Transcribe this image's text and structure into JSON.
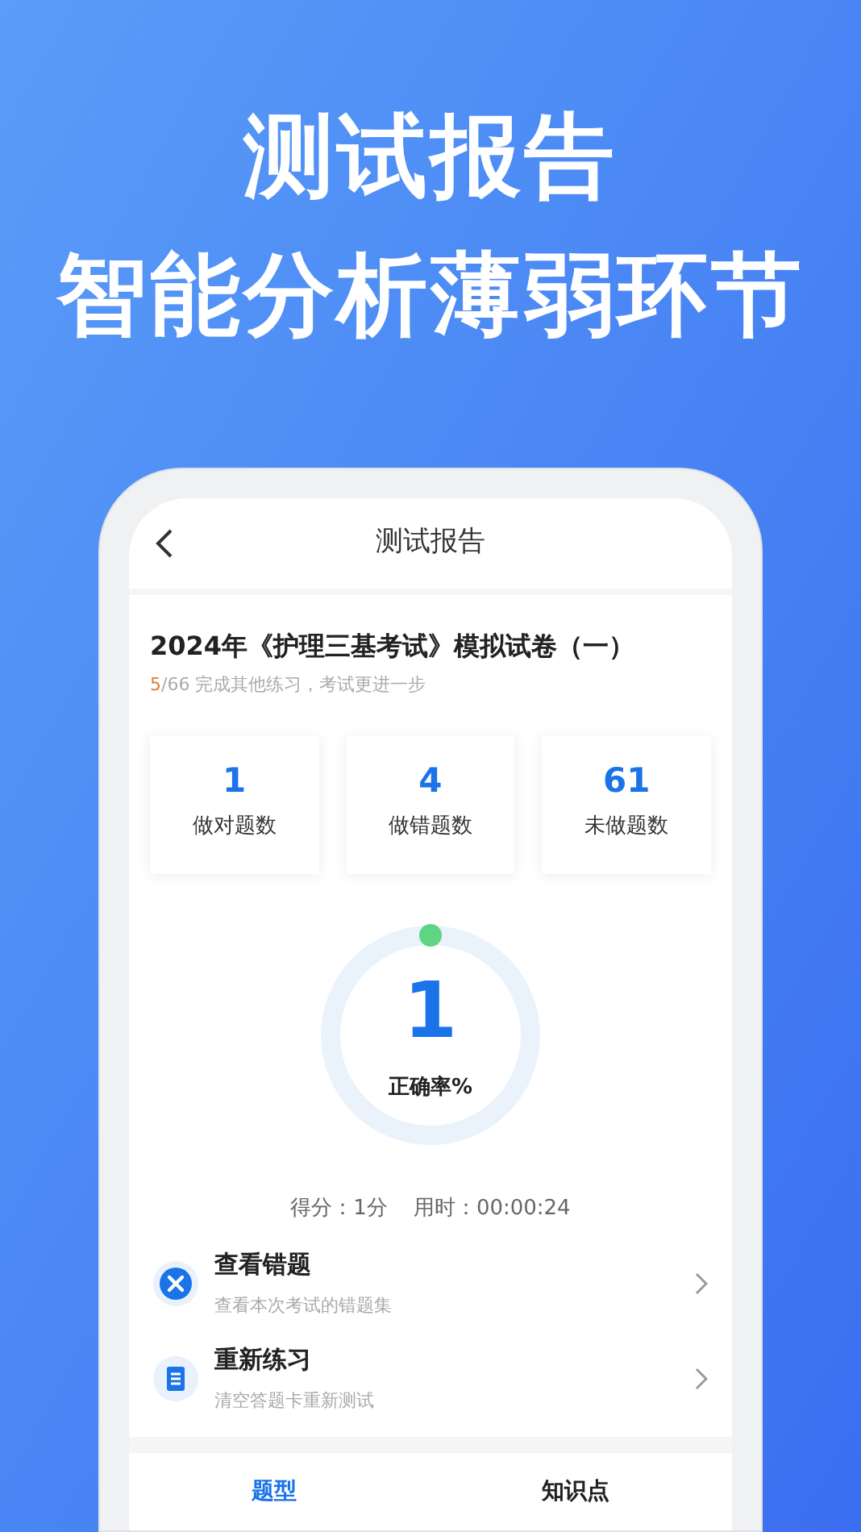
{
  "headline": [
    "测试报告",
    "智能分析薄弱环节"
  ],
  "nav": {
    "title": "测试报告"
  },
  "exam": {
    "title": "2024年《护理三基考试》模拟试卷（一）",
    "progress_done": "5",
    "progress_rest": "/66 完成其他练习，考试更进一步"
  },
  "stats": [
    {
      "value": "1",
      "label": "做对题数"
    },
    {
      "value": "4",
      "label": "做错题数"
    },
    {
      "value": "61",
      "label": "未做题数"
    }
  ],
  "accuracy": {
    "value": "1",
    "label": "正确率%"
  },
  "summary": {
    "score": "得分：1分",
    "time": "用时：00:00:24"
  },
  "actions": [
    {
      "kind": "wrong",
      "title": "查看错题",
      "subtitle": "查看本次考试的错题集"
    },
    {
      "kind": "retry",
      "title": "重新练习",
      "subtitle": "清空答题卡重新测试"
    }
  ],
  "tabs": [
    {
      "label": "题型",
      "selected": true
    },
    {
      "label": "知识点",
      "selected": false
    }
  ]
}
